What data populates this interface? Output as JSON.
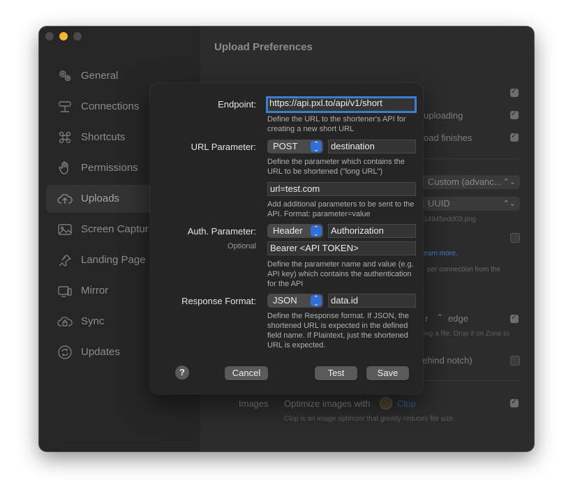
{
  "window": {
    "title": "Upload Preferences"
  },
  "sidebar": {
    "items": [
      {
        "label": "General",
        "icon": "gears-icon"
      },
      {
        "label": "Connections",
        "icon": "network-icon"
      },
      {
        "label": "Shortcuts",
        "icon": "command-icon"
      },
      {
        "label": "Permissions",
        "icon": "hand-icon"
      },
      {
        "label": "Uploads",
        "icon": "cloud-upload-icon",
        "active": true
      },
      {
        "label": "Screen Captur",
        "icon": "photo-icon"
      },
      {
        "label": "Landing Page",
        "icon": "pin-icon"
      },
      {
        "label": "Mirror",
        "icon": "mirror-icon"
      },
      {
        "label": "Sync",
        "icon": "cloud-lock-icon"
      },
      {
        "label": "Updates",
        "icon": "updates-icon"
      }
    ]
  },
  "background": {
    "uploading": "uploading",
    "load_finishes": "oad finishes",
    "select_custom": "Custom (advanc...",
    "select_uuid": "UUID",
    "filename": "14945edd03.png",
    "learn_more": "earn more.",
    "per_connection": "per   connection   from   the",
    "edge": "edge",
    "edge_prefix": "r",
    "drop_text": "ing a file. Drop it on Zone to",
    "notch": "ehind notch)",
    "images_label": "Images",
    "optimize_text": "Optimize images with",
    "clop": "Clop",
    "clop_desc": "Clop is an image optimzer that greatly reduces file size."
  },
  "sheet": {
    "endpoint": {
      "label": "Endpoint:",
      "value": "https://api.pxl.to/api/v1/short",
      "help": "Define the URL to the shortener's API for creating a new short URL"
    },
    "url_parameter": {
      "label": "URL Parameter:",
      "method": "POST",
      "value": "destination",
      "help": "Define the parameter which contains the URL to be shortened (\"long URL\")"
    },
    "additional": {
      "value": "url=test.com",
      "help": "Add additional parameters to be sent to the API. Format: parameter=value"
    },
    "auth": {
      "label": "Auth. Parameter:",
      "optional": "Optional",
      "type": "Header",
      "name": "Authorization",
      "value": "Bearer <API TOKEN>",
      "help": "Define the parameter name and value (e.g. API key) which contains the authentication for the API"
    },
    "response": {
      "label": "Response Format:",
      "format": "JSON",
      "field": "data.id",
      "help": "Define the Response format. If JSON, the shortened URL is expected in the defined field name. If Plaintext, just the shortened URL is expected."
    },
    "buttons": {
      "help": "?",
      "cancel": "Cancel",
      "test": "Test",
      "save": "Save"
    }
  },
  "colors": {
    "accent": "#2f6fd6",
    "focus": "#3c7ed6",
    "traffic_min": "#f5b631",
    "link": "#3d7fd6"
  }
}
